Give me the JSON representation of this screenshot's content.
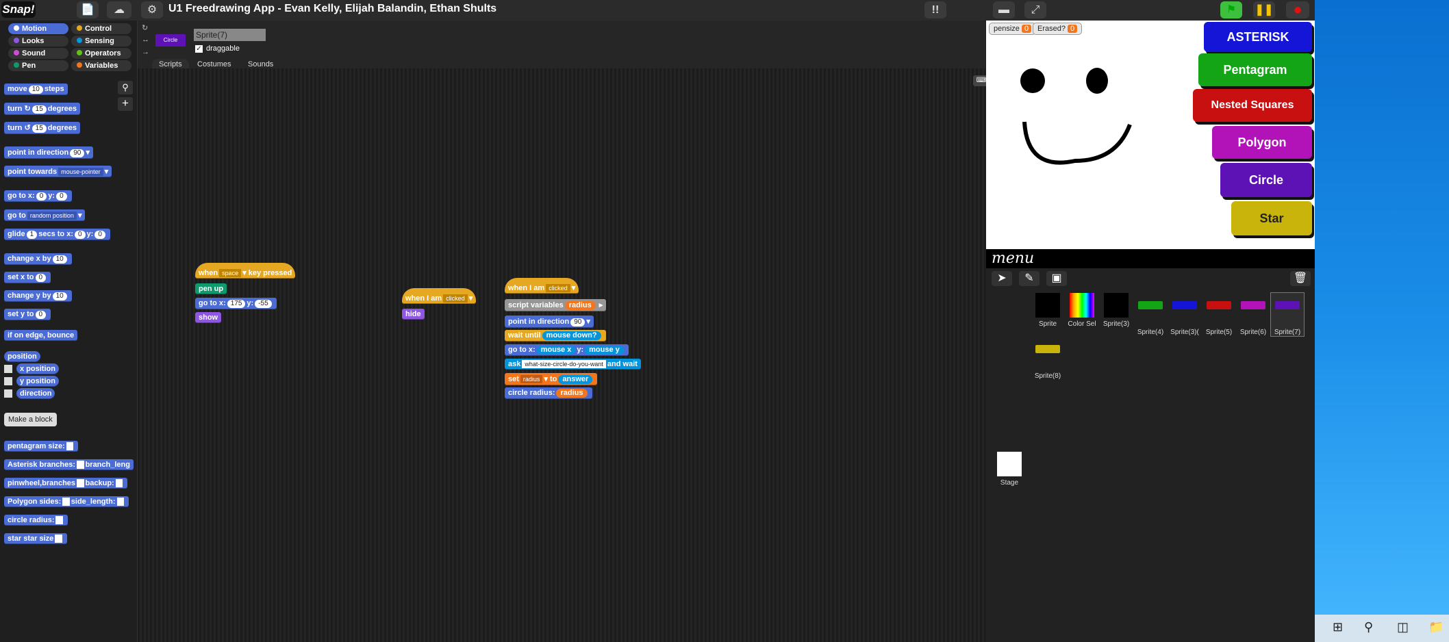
{
  "app": {
    "logo": "Snap!",
    "title": "U1 Freedrawing App - Evan Kelly, Elijah Balandin, Ethan Shults"
  },
  "categories": [
    {
      "label": "Motion",
      "color": "#4a6cd4"
    },
    {
      "label": "Control",
      "color": "#e6a822"
    },
    {
      "label": "Looks",
      "color": "#8f56e3"
    },
    {
      "label": "Sensing",
      "color": "#0494dc"
    },
    {
      "label": "Sound",
      "color": "#cf4ad9"
    },
    {
      "label": "Operators",
      "color": "#62c213"
    },
    {
      "label": "Pen",
      "color": "#0e9a6c"
    },
    {
      "label": "Variables",
      "color": "#f3761d"
    }
  ],
  "palette": {
    "move": {
      "a": "move",
      "v": "10",
      "b": "steps"
    },
    "turn_cw": {
      "a": "turn",
      "v": "15",
      "b": "degrees"
    },
    "turn_ccw": {
      "a": "turn",
      "v": "15",
      "b": "degrees"
    },
    "point_dir": {
      "a": "point in direction",
      "v": "90"
    },
    "point_towards": {
      "a": "point towards",
      "v": "mouse-pointer"
    },
    "goto_xy": {
      "a": "go to x:",
      "x": "0",
      "b": "y:",
      "y": "0"
    },
    "goto": {
      "a": "go to",
      "v": "random position"
    },
    "glide": {
      "a": "glide",
      "v": "1",
      "b": "secs to x:",
      "x": "0",
      "c": "y:",
      "y": "0"
    },
    "change_x": {
      "a": "change x by",
      "v": "10"
    },
    "set_x": {
      "a": "set x to",
      "v": "0"
    },
    "change_y": {
      "a": "change y by",
      "v": "10"
    },
    "set_y": {
      "a": "set y to",
      "v": "0"
    },
    "bounce": "if on edge, bounce",
    "position": "position",
    "x_position": "x position",
    "y_position": "y position",
    "direction": "direction",
    "make_block": "Make a block",
    "custom": [
      {
        "a": "pentagram size:"
      },
      {
        "a": "Asterisk branches:",
        "b": "branch_leng"
      },
      {
        "a": "pinwheel,branches",
        "b": "backup:"
      },
      {
        "a": "Polygon sides:",
        "b": "side_length:"
      },
      {
        "a": "circle radius:"
      },
      {
        "a": "star star size"
      }
    ]
  },
  "sprite_header": {
    "name": "Sprite(7)",
    "draggable_label": "draggable",
    "costume_label": "Circle"
  },
  "tabs": [
    "Scripts",
    "Costumes",
    "Sounds"
  ],
  "scripts": {
    "s1": {
      "hat_a": "when",
      "hat_key": "space",
      "hat_b": "key pressed",
      "pen_up": "pen up",
      "goto_a": "go to x:",
      "goto_x": "175",
      "goto_b": "y:",
      "goto_y": "-55",
      "show": "show"
    },
    "s2": {
      "hat_a": "when I am",
      "hat_v": "clicked",
      "hide": "hide"
    },
    "s3": {
      "hat_a": "when I am",
      "hat_v": "clicked",
      "script_vars": "script variables",
      "var_name": "radius",
      "point_a": "point in direction",
      "point_v": "90",
      "wait_a": "wait until",
      "wait_v": "mouse down?",
      "goto_a": "go to x:",
      "goto_x": "mouse x",
      "goto_b": "y:",
      "goto_y": "mouse y",
      "ask_a": "ask",
      "ask_v": "what-size-circle-do-you-want",
      "ask_b": "and wait",
      "set_a": "set",
      "set_var": "radius",
      "set_b": "to",
      "set_v": "answer",
      "circle_a": "circle radius:",
      "circle_v": "radius"
    }
  },
  "stage": {
    "watchers": [
      {
        "label": "pensize",
        "value": "0"
      },
      {
        "label": "Erased?",
        "value": "0"
      }
    ],
    "buttons": [
      {
        "label": "ASTERISK",
        "color": "#1515d8"
      },
      {
        "label": "Pentagram",
        "color": "#13a516"
      },
      {
        "label": "Nested Squares",
        "color": "#c81010"
      },
      {
        "label": "Polygon",
        "color": "#b213b8"
      },
      {
        "label": "Circle",
        "color": "#5d12b5"
      },
      {
        "label": "Star",
        "color": "#c9b40b"
      }
    ],
    "menu_text": "menu"
  },
  "sprites": [
    {
      "name": "Sprite",
      "thumb": "#000000"
    },
    {
      "name": "Color Sel",
      "thumb": "rainbow"
    },
    {
      "name": "Sprite(3)",
      "thumb": "#000000"
    },
    {
      "name": "Sprite(4)",
      "thumb": "#13a516"
    },
    {
      "name": "Sprite(3)(",
      "thumb": "#1515d8"
    },
    {
      "name": "Sprite(5)",
      "thumb": "#c81010"
    },
    {
      "name": "Sprite(6)",
      "thumb": "#b213b8"
    },
    {
      "name": "Sprite(7)",
      "thumb": "#5d12b5"
    },
    {
      "name": "Sprite(8)",
      "thumb": "#c9b40b"
    }
  ],
  "stage_icon_label": "Stage"
}
